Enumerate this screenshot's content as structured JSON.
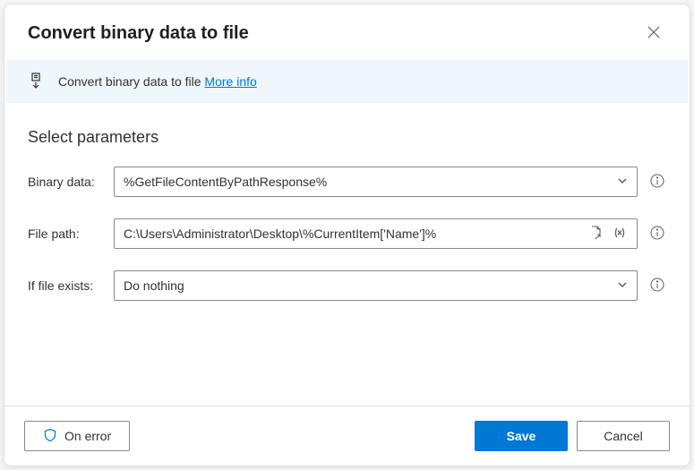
{
  "header": {
    "title": "Convert binary data to file"
  },
  "banner": {
    "text": "Convert binary data to file",
    "more_info": "More info"
  },
  "section_title": "Select parameters",
  "fields": {
    "binary_data": {
      "label": "Binary data:",
      "value": "%GetFileContentByPathResponse%"
    },
    "file_path": {
      "label": "File path:",
      "value": "C:\\Users\\Administrator\\Desktop\\%CurrentItem['Name']%"
    },
    "if_file_exists": {
      "label": "If file exists:",
      "value": "Do nothing"
    }
  },
  "footer": {
    "on_error": "On error",
    "save": "Save",
    "cancel": "Cancel"
  }
}
